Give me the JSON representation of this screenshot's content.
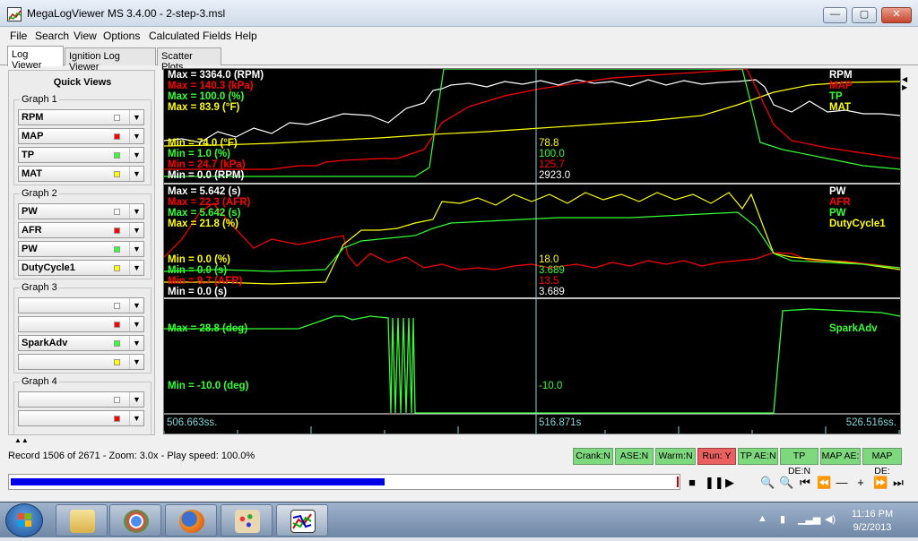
{
  "window": {
    "title": "MegaLogViewer MS 3.4.00 - 2-step-3.msl",
    "minimize": "—",
    "maximize": "▢",
    "close": "✕"
  },
  "menu": [
    "File",
    "Search",
    "View",
    "Options",
    "Calculated Fields",
    "Help"
  ],
  "tabs": [
    "Log Viewer",
    "Ignition Log Viewer",
    "Scatter Plots"
  ],
  "quick_views": {
    "title": "Quick Views",
    "groups": [
      {
        "label": "Graph 1",
        "fields": [
          {
            "name": "RPM",
            "color": "#ffffff"
          },
          {
            "name": "MAP",
            "color": "#ff0000"
          },
          {
            "name": "TP",
            "color": "#33ff33"
          },
          {
            "name": "MAT",
            "color": "#ffff00"
          }
        ]
      },
      {
        "label": "Graph 2",
        "fields": [
          {
            "name": "PW",
            "color": "#ffffff"
          },
          {
            "name": "AFR",
            "color": "#ff0000"
          },
          {
            "name": "PW",
            "color": "#33ff33"
          },
          {
            "name": "DutyCycle1",
            "color": "#ffff00"
          }
        ]
      },
      {
        "label": "Graph 3",
        "fields": [
          {
            "name": "",
            "color": "#ffffff"
          },
          {
            "name": "",
            "color": "#ff0000"
          },
          {
            "name": "SparkAdv",
            "color": "#33ff33"
          },
          {
            "name": "",
            "color": "#ffff00"
          }
        ]
      },
      {
        "label": "Graph 4",
        "fields": [
          {
            "name": "",
            "color": "#ffffff"
          },
          {
            "name": "",
            "color": "#ff0000"
          }
        ]
      }
    ]
  },
  "graphs": {
    "g1": {
      "max": [
        "Max = 3364.0 (RPM)",
        "Max = 140.3 (kPa)",
        "Max = 100.0 (%)",
        "Max = 83.9 (°F)"
      ],
      "min": [
        "Min = 74.0 (°F)",
        "Min = 1.0 (%)",
        "Min = 24.7 (kPa)",
        "Min = 0.0 (RPM)"
      ],
      "legend": [
        "RPM",
        "MAP",
        "TP",
        "MAT"
      ],
      "cursor": [
        "78.8",
        "100.0",
        "125.7",
        "2923.0"
      ]
    },
    "g2": {
      "max": [
        "Max = 5.642 (s)",
        "Max = 22.3 (AFR)",
        "Max = 5.642 (s)",
        "Max = 21.8 (%)"
      ],
      "min": [
        "Min = 0.0 (%)",
        "Min = 0.0 (s)",
        "Min = 9.7 (AFR)",
        "Min = 0.0 (s)"
      ],
      "legend": [
        "PW",
        "AFR",
        "PW",
        "DutyCycle1"
      ],
      "cursor": [
        "18.0",
        "3.689",
        "13.5",
        "3.689"
      ]
    },
    "g3": {
      "max": "Max = 28.8 (deg)",
      "min": "Min = -10.0 (deg)",
      "legend": "SparkAdv",
      "cursor": "-10.0"
    },
    "time_axis": {
      "start": "506.663ss.",
      "cursor": "516.871s",
      "end": "526.516ss."
    }
  },
  "colors": {
    "white": "#ffffff",
    "red": "#ff0000",
    "green": "#33ff33",
    "yellow": "#ffff00",
    "cursor": "#7fd8d8"
  },
  "status_text": "Record 1506 of 2671 - Zoom: 3.0x - Play speed: 100.0%",
  "indicators": [
    {
      "label": "Crank:N",
      "state": "off"
    },
    {
      "label": "ASE:N",
      "state": "off"
    },
    {
      "label": "Warm:N",
      "state": "off"
    },
    {
      "label": "Run: Y",
      "state": "on"
    },
    {
      "label": "TP AE:N",
      "state": "off"
    },
    {
      "label": "TP DE:N",
      "state": "off"
    },
    {
      "label": "MAP AE:",
      "state": "off"
    },
    {
      "label": "MAP DE:",
      "state": "off"
    }
  ],
  "progress": {
    "fraction": 0.56
  },
  "playback_controls": [
    "stop-icon",
    "pause-icon",
    "play-icon",
    "zoom-out-icon",
    "zoom-in-icon",
    "first-icon",
    "rewind-icon",
    "minus-icon",
    "plus-icon",
    "fast-forward-icon",
    "last-icon"
  ],
  "taskbar": {
    "apps": [
      "explorer-icon",
      "chrome-icon",
      "firefox-icon",
      "paint-icon",
      "megalogviewer-icon"
    ],
    "time": "11:16 PM",
    "date": "9/2/2013"
  }
}
